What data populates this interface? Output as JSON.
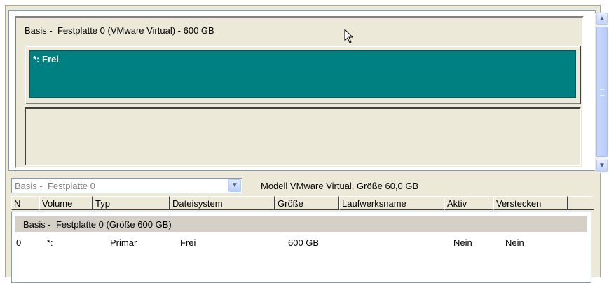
{
  "disk_map": {
    "title": "Basis -  Festplatte 0 (VMware Virtual) - 600 GB",
    "partition_label": "*: Frei",
    "partition_color": "#008080"
  },
  "disk_select": {
    "value": "Basis -  Festplatte 0"
  },
  "model_info": "Modell VMware Virtual, Größe 60,0 GB",
  "table": {
    "headers": [
      "N",
      "Volume",
      "Typ",
      "Dateisystem",
      "Größe",
      "Laufwerksname",
      "Aktiv",
      "Verstecken"
    ],
    "group_label": "Basis -  Festplatte 0 (Größe 600 GB)",
    "rows": [
      {
        "n": "0",
        "volume": "*:",
        "typ": "Primär",
        "dateisystem": "Frei",
        "groesse": "600 GB",
        "laufwerksname": "",
        "aktiv": "Nein",
        "verstecken": "Nein"
      }
    ]
  },
  "icons": {
    "scroll_up": "chevron-up-icon",
    "scroll_down": "chevron-down-icon",
    "dropdown": "chevron-down-icon"
  }
}
